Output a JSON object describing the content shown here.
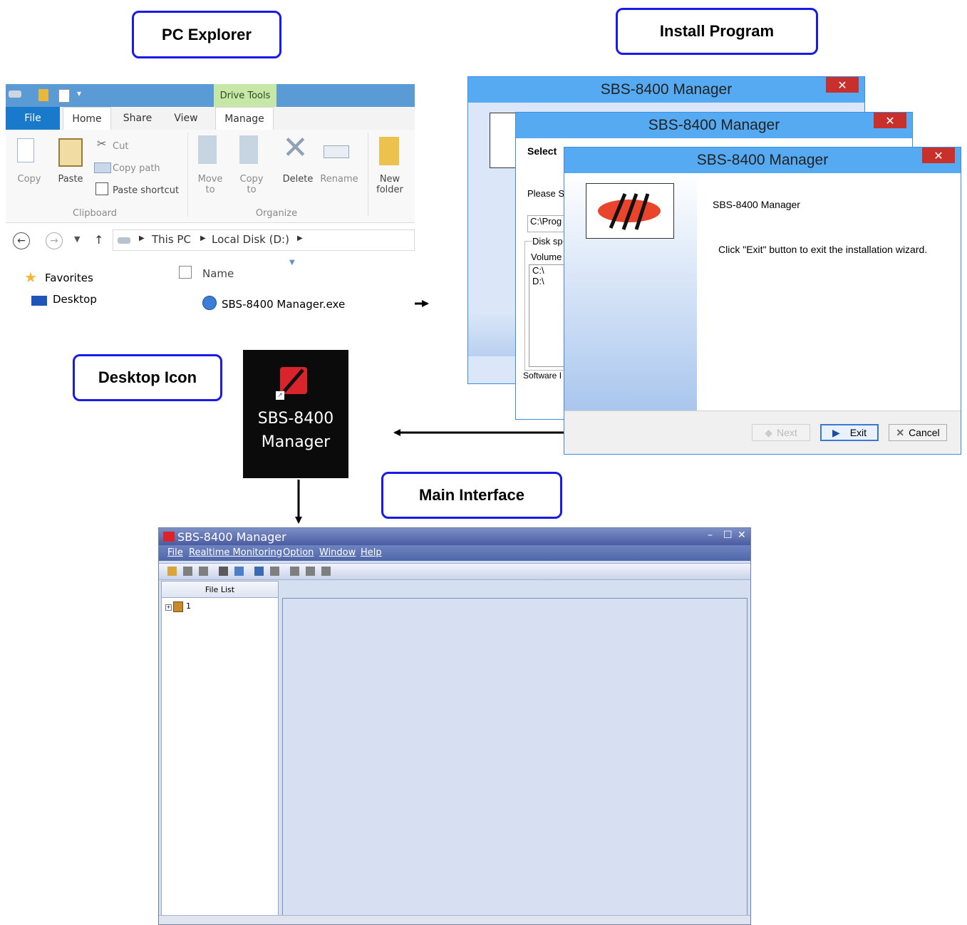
{
  "labels": {
    "pc_explorer": "PC Explorer",
    "install_program": "Install Program",
    "desktop_icon": "Desktop Icon",
    "main_interface": "Main Interface"
  },
  "explorer": {
    "drive_tools": "Drive Tools",
    "tabs": [
      "File",
      "Home",
      "Share",
      "View",
      "Manage"
    ],
    "ribbon": {
      "copy": "Copy",
      "paste": "Paste",
      "cut": "Cut",
      "copy_path": "Copy path",
      "paste_shortcut": "Paste shortcut",
      "move_to": [
        "Move",
        "to"
      ],
      "copy_to": [
        "Copy",
        "to"
      ],
      "delete": "Delete",
      "rename": "Rename",
      "new_folder": [
        "New",
        "folder"
      ],
      "group_clipboard": "Clipboard",
      "group_organize": "Organize"
    },
    "breadcrumb": [
      "This PC",
      "Local Disk (D:)"
    ],
    "nav": [
      "Favorites",
      "Desktop"
    ],
    "column_name": "Name",
    "file": "SBS-8400 Manager.exe"
  },
  "installer": {
    "title": "SBS-8400 Manager",
    "close": "✕",
    "back1": {
      "select": "Select",
      "please": "Please S",
      "path": "C:\\Prog",
      "disk_space": "Disk sp",
      "volume": "Volume",
      "drives": [
        "C:\\",
        "D:\\"
      ],
      "software": "Software I"
    },
    "front": {
      "product": "SBS-8400 Manager",
      "message": "Click \"Exit\" button to exit the installation wizard.",
      "next": "Next",
      "exit": "Exit",
      "cancel": "Cancel"
    }
  },
  "desktop": {
    "line1": "SBS-8400",
    "line2": "Manager"
  },
  "main": {
    "title": "SBS-8400 Manager",
    "menu": [
      "File",
      "Realtime Monitoring",
      "Option",
      "Window",
      "Help"
    ],
    "file_list": "File List",
    "tree_item": "1",
    "window_buttons": [
      "–",
      "☐",
      "✕"
    ]
  },
  "colors": {
    "label_border": "#1a1ae6",
    "accent_blue": "#56aaf2",
    "close_red": "#c8302c",
    "logo_red": "#e8452c"
  }
}
